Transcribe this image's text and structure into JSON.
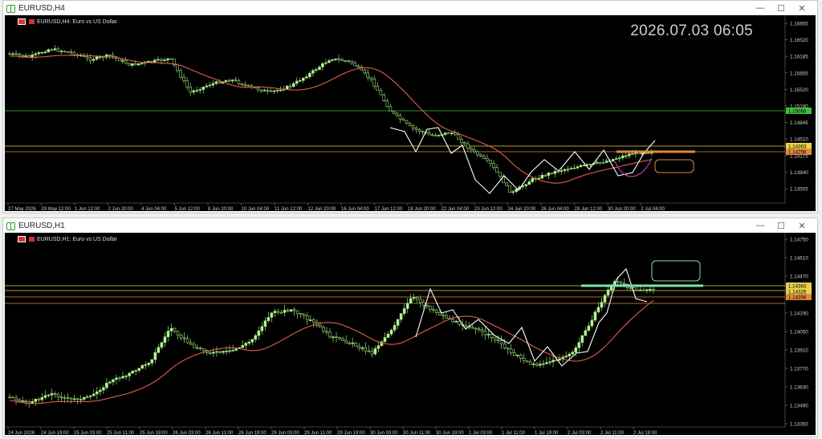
{
  "top": {
    "title": "EURUSD,H4",
    "label": "EURUSD,H4:  Euro vs US Dollar",
    "clock": "2026.07.03 06:05",
    "price_labels": [
      "1.16855",
      "1.16520",
      "1.16185",
      "1.15855",
      "1.15520",
      "1.15180",
      "1.14845",
      "1.14510",
      "1.14175",
      "1.13840",
      "1.13505"
    ],
    "highlight_prices": [
      {
        "text": "1.15066",
        "color": "#3fbf3f"
      },
      {
        "text": "1.14363",
        "color": "#e8d24a"
      },
      {
        "text": "1.14256",
        "color": "#e08a3a"
      }
    ],
    "time_labels": [
      "27 May 2026",
      "29 May 12:00",
      "1 Jun 12:00",
      "2 Jun 20:00",
      "4 Jun 04:00",
      "5 Jun 12:00",
      "8 Jun 20:00",
      "10 Jun 04:00",
      "11 Jun 12:00",
      "12 Jun 20:00",
      "16 Jun 04:00",
      "17 Jun 12:00",
      "18 Jun 20:00",
      "22 Jun 04:00",
      "23 Jun 12:00",
      "24 Jun 20:00",
      "26 Jun 04:00",
      "29 Jun 12:00",
      "30 Jun 20:00",
      "2 Jul 04:00"
    ]
  },
  "bottom": {
    "title": "EURUSD,H1",
    "label": "EURUSD,H1:  Euro vs US Dollar",
    "price_labels": [
      "1.14750",
      "1.14610",
      "1.14470",
      "1.14330",
      "1.14190",
      "1.14050",
      "1.13910",
      "1.13770",
      "1.13630",
      "1.13490",
      "1.13350"
    ],
    "highlight_prices": [
      {
        "text": "1.14363",
        "color": "#e8d24a"
      },
      {
        "text": "1.14326",
        "color": "#e8d24a"
      },
      {
        "text": "1.14256",
        "color": "#e08a3a"
      }
    ],
    "time_labels": [
      "24 Jun 2026",
      "24 Jun 19:00",
      "25 Jun 03:00",
      "25 Jun 11:00",
      "25 Jun 19:00",
      "26 Jun 03:00",
      "26 Jun 11:00",
      "26 Jun 19:00",
      "29 Jun 03:00",
      "29 Jun 11:00",
      "29 Jun 19:00",
      "30 Jun 03:00",
      "30 Jun 11:00",
      "30 Jun 19:00",
      "1 Jul 03:00",
      "1 Jul 11:00",
      "1 Jul 19:00",
      "2 Jul 03:00",
      "2 Jul 11:00",
      "2 Jul 19:00"
    ]
  },
  "window_controls": {
    "minimize": "—",
    "maximize": "☐",
    "close": "✕"
  },
  "colors": {
    "bull": "#9be37a",
    "ma": "#e0604a",
    "zigzag": "#ffffff",
    "level_green": "#3fbf3f",
    "level_yellow": "#e8d24a",
    "level_orange": "#e08a3a",
    "zone_box": "#7fe0b0"
  }
}
